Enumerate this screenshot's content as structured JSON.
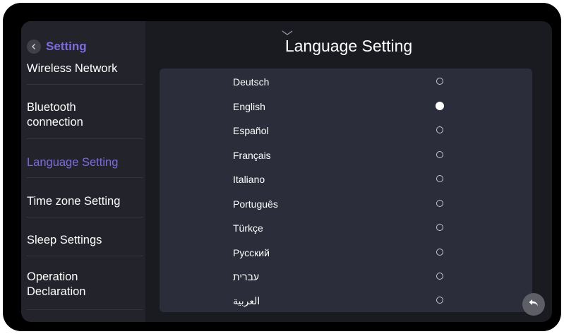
{
  "header": {
    "back_label": "Setting",
    "title": "Language Setting"
  },
  "sidebar": {
    "items": [
      {
        "label": "Wireless Network",
        "active": false
      },
      {
        "label": "Bluetooth\nconnection",
        "active": false
      },
      {
        "label": "Language Setting",
        "active": true
      },
      {
        "label": "Time zone Setting",
        "active": false
      },
      {
        "label": "Sleep Settings",
        "active": false
      },
      {
        "label": "Operation\nDeclaration",
        "active": false
      }
    ]
  },
  "languages": {
    "options": [
      {
        "label": "Deutsch",
        "selected": false
      },
      {
        "label": "English",
        "selected": true
      },
      {
        "label": "Español",
        "selected": false
      },
      {
        "label": "Français",
        "selected": false
      },
      {
        "label": "Italiano",
        "selected": false
      },
      {
        "label": "Português",
        "selected": false
      },
      {
        "label": "Türkçe",
        "selected": false
      },
      {
        "label": "Русский",
        "selected": false
      },
      {
        "label": "עברית",
        "selected": false
      },
      {
        "label": "العربية",
        "selected": false
      }
    ]
  },
  "colors": {
    "accent": "#7c6ce0",
    "background": "#1a1b21",
    "sidebar": "#23242b",
    "panel": "#2b2e3a"
  },
  "icons": {
    "back": "chevron-left-icon",
    "pull_down": "chevron-down-icon",
    "return": "return-arrow-icon"
  }
}
